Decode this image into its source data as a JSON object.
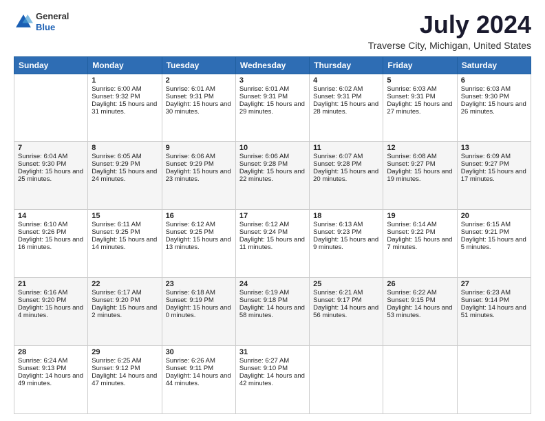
{
  "logo": {
    "general": "General",
    "blue": "Blue"
  },
  "title": "July 2024",
  "location": "Traverse City, Michigan, United States",
  "weekdays": [
    "Sunday",
    "Monday",
    "Tuesday",
    "Wednesday",
    "Thursday",
    "Friday",
    "Saturday"
  ],
  "weeks": [
    [
      {
        "day": "",
        "sunrise": "",
        "sunset": "",
        "daylight": ""
      },
      {
        "day": "1",
        "sunrise": "Sunrise: 6:00 AM",
        "sunset": "Sunset: 9:32 PM",
        "daylight": "Daylight: 15 hours and 31 minutes."
      },
      {
        "day": "2",
        "sunrise": "Sunrise: 6:01 AM",
        "sunset": "Sunset: 9:31 PM",
        "daylight": "Daylight: 15 hours and 30 minutes."
      },
      {
        "day": "3",
        "sunrise": "Sunrise: 6:01 AM",
        "sunset": "Sunset: 9:31 PM",
        "daylight": "Daylight: 15 hours and 29 minutes."
      },
      {
        "day": "4",
        "sunrise": "Sunrise: 6:02 AM",
        "sunset": "Sunset: 9:31 PM",
        "daylight": "Daylight: 15 hours and 28 minutes."
      },
      {
        "day": "5",
        "sunrise": "Sunrise: 6:03 AM",
        "sunset": "Sunset: 9:31 PM",
        "daylight": "Daylight: 15 hours and 27 minutes."
      },
      {
        "day": "6",
        "sunrise": "Sunrise: 6:03 AM",
        "sunset": "Sunset: 9:30 PM",
        "daylight": "Daylight: 15 hours and 26 minutes."
      }
    ],
    [
      {
        "day": "7",
        "sunrise": "Sunrise: 6:04 AM",
        "sunset": "Sunset: 9:30 PM",
        "daylight": "Daylight: 15 hours and 25 minutes."
      },
      {
        "day": "8",
        "sunrise": "Sunrise: 6:05 AM",
        "sunset": "Sunset: 9:29 PM",
        "daylight": "Daylight: 15 hours and 24 minutes."
      },
      {
        "day": "9",
        "sunrise": "Sunrise: 6:06 AM",
        "sunset": "Sunset: 9:29 PM",
        "daylight": "Daylight: 15 hours and 23 minutes."
      },
      {
        "day": "10",
        "sunrise": "Sunrise: 6:06 AM",
        "sunset": "Sunset: 9:28 PM",
        "daylight": "Daylight: 15 hours and 22 minutes."
      },
      {
        "day": "11",
        "sunrise": "Sunrise: 6:07 AM",
        "sunset": "Sunset: 9:28 PM",
        "daylight": "Daylight: 15 hours and 20 minutes."
      },
      {
        "day": "12",
        "sunrise": "Sunrise: 6:08 AM",
        "sunset": "Sunset: 9:27 PM",
        "daylight": "Daylight: 15 hours and 19 minutes."
      },
      {
        "day": "13",
        "sunrise": "Sunrise: 6:09 AM",
        "sunset": "Sunset: 9:27 PM",
        "daylight": "Daylight: 15 hours and 17 minutes."
      }
    ],
    [
      {
        "day": "14",
        "sunrise": "Sunrise: 6:10 AM",
        "sunset": "Sunset: 9:26 PM",
        "daylight": "Daylight: 15 hours and 16 minutes."
      },
      {
        "day": "15",
        "sunrise": "Sunrise: 6:11 AM",
        "sunset": "Sunset: 9:25 PM",
        "daylight": "Daylight: 15 hours and 14 minutes."
      },
      {
        "day": "16",
        "sunrise": "Sunrise: 6:12 AM",
        "sunset": "Sunset: 9:25 PM",
        "daylight": "Daylight: 15 hours and 13 minutes."
      },
      {
        "day": "17",
        "sunrise": "Sunrise: 6:12 AM",
        "sunset": "Sunset: 9:24 PM",
        "daylight": "Daylight: 15 hours and 11 minutes."
      },
      {
        "day": "18",
        "sunrise": "Sunrise: 6:13 AM",
        "sunset": "Sunset: 9:23 PM",
        "daylight": "Daylight: 15 hours and 9 minutes."
      },
      {
        "day": "19",
        "sunrise": "Sunrise: 6:14 AM",
        "sunset": "Sunset: 9:22 PM",
        "daylight": "Daylight: 15 hours and 7 minutes."
      },
      {
        "day": "20",
        "sunrise": "Sunrise: 6:15 AM",
        "sunset": "Sunset: 9:21 PM",
        "daylight": "Daylight: 15 hours and 5 minutes."
      }
    ],
    [
      {
        "day": "21",
        "sunrise": "Sunrise: 6:16 AM",
        "sunset": "Sunset: 9:20 PM",
        "daylight": "Daylight: 15 hours and 4 minutes."
      },
      {
        "day": "22",
        "sunrise": "Sunrise: 6:17 AM",
        "sunset": "Sunset: 9:20 PM",
        "daylight": "Daylight: 15 hours and 2 minutes."
      },
      {
        "day": "23",
        "sunrise": "Sunrise: 6:18 AM",
        "sunset": "Sunset: 9:19 PM",
        "daylight": "Daylight: 15 hours and 0 minutes."
      },
      {
        "day": "24",
        "sunrise": "Sunrise: 6:19 AM",
        "sunset": "Sunset: 9:18 PM",
        "daylight": "Daylight: 14 hours and 58 minutes."
      },
      {
        "day": "25",
        "sunrise": "Sunrise: 6:21 AM",
        "sunset": "Sunset: 9:17 PM",
        "daylight": "Daylight: 14 hours and 56 minutes."
      },
      {
        "day": "26",
        "sunrise": "Sunrise: 6:22 AM",
        "sunset": "Sunset: 9:15 PM",
        "daylight": "Daylight: 14 hours and 53 minutes."
      },
      {
        "day": "27",
        "sunrise": "Sunrise: 6:23 AM",
        "sunset": "Sunset: 9:14 PM",
        "daylight": "Daylight: 14 hours and 51 minutes."
      }
    ],
    [
      {
        "day": "28",
        "sunrise": "Sunrise: 6:24 AM",
        "sunset": "Sunset: 9:13 PM",
        "daylight": "Daylight: 14 hours and 49 minutes."
      },
      {
        "day": "29",
        "sunrise": "Sunrise: 6:25 AM",
        "sunset": "Sunset: 9:12 PM",
        "daylight": "Daylight: 14 hours and 47 minutes."
      },
      {
        "day": "30",
        "sunrise": "Sunrise: 6:26 AM",
        "sunset": "Sunset: 9:11 PM",
        "daylight": "Daylight: 14 hours and 44 minutes."
      },
      {
        "day": "31",
        "sunrise": "Sunrise: 6:27 AM",
        "sunset": "Sunset: 9:10 PM",
        "daylight": "Daylight: 14 hours and 42 minutes."
      },
      {
        "day": "",
        "sunrise": "",
        "sunset": "",
        "daylight": ""
      },
      {
        "day": "",
        "sunrise": "",
        "sunset": "",
        "daylight": ""
      },
      {
        "day": "",
        "sunrise": "",
        "sunset": "",
        "daylight": ""
      }
    ]
  ]
}
